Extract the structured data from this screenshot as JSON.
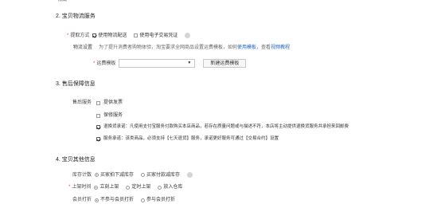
{
  "top_cut_text": "物流",
  "section2": {
    "title": "2. 宝贝物流服务",
    "pickup": {
      "label": "提取方式",
      "option1": "使用物流配送",
      "option2": "使用电子交易凭证"
    },
    "shipping_setting": {
      "label": "物流设置",
      "text": "为了提升消费者购物体验，淘宝要求全网商品设置运费模板，如何",
      "link1": "使用模板",
      "mid": "，查看",
      "link2": "视频教程"
    },
    "template": {
      "label": "运费模板",
      "select_value": "",
      "new_button": "新建运费模板"
    }
  },
  "section3": {
    "title": "3. 售后保障信息",
    "service_label": "售后服务",
    "items": [
      {
        "label": "提供发票",
        "checked": false
      },
      {
        "label": "保修服务",
        "checked": false
      },
      {
        "label": "退换货承诺：凡使用支付宝服务付款购买本店商品，若存在质量问题或与描述不符，本店将主动提供退换货服务并承担来回邮费",
        "checked": true
      },
      {
        "label": "服务承诺：该类商品，必须支持【七天退货】服务，承诺更好服务可通过【交易合约】设置",
        "checked": true
      }
    ]
  },
  "section4": {
    "title": "4. 宝贝其他信息",
    "stock": {
      "label": "库存计数",
      "option1": "买家拍下减库存",
      "option2": "买家付款减库存"
    },
    "listing": {
      "label": "上架时间",
      "option1": "立刻上架",
      "option2": "定时上架",
      "option3": "放入仓库"
    },
    "member": {
      "label": "会员打折",
      "option1": "不参与会员打折",
      "option2": "参与会员打折"
    }
  },
  "colors": {
    "link": "#1f63c6",
    "required": "#e4393c"
  }
}
